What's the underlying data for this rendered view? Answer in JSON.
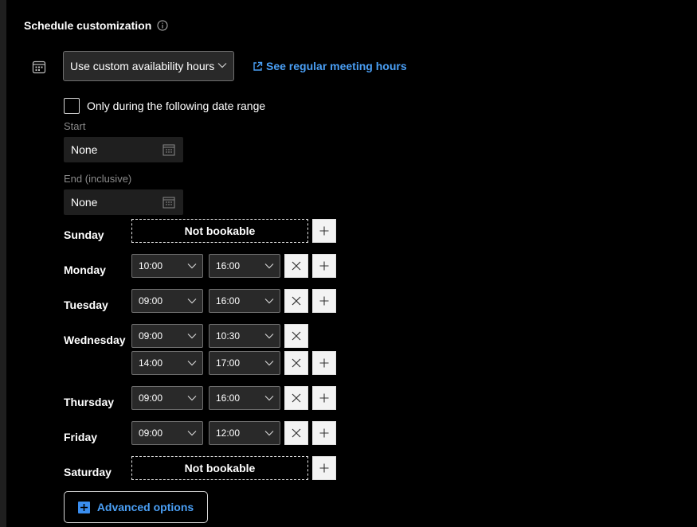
{
  "header": {
    "title": "Schedule customization",
    "info_icon": "info-icon"
  },
  "availability": {
    "mode": "Use custom availability hours",
    "link": "See regular meeting hours",
    "date_range_checkbox": "Only during the following date range",
    "date_range_checked": false
  },
  "dates": {
    "start_label": "Start",
    "start_value": "None",
    "end_label": "End (inclusive)",
    "end_value": "None"
  },
  "days": {
    "sunday": {
      "label": "Sunday",
      "status": "Not bookable"
    },
    "monday": {
      "label": "Monday",
      "slots": [
        {
          "from": "10:00",
          "to": "16:00"
        }
      ]
    },
    "tuesday": {
      "label": "Tuesday",
      "slots": [
        {
          "from": "09:00",
          "to": "16:00"
        }
      ]
    },
    "wednesday": {
      "label": "Wednesday",
      "slots": [
        {
          "from": "09:00",
          "to": "10:30"
        },
        {
          "from": "14:00",
          "to": "17:00"
        }
      ]
    },
    "thursday": {
      "label": "Thursday",
      "slots": [
        {
          "from": "09:00",
          "to": "16:00"
        }
      ]
    },
    "friday": {
      "label": "Friday",
      "slots": [
        {
          "from": "09:00",
          "to": "12:00"
        }
      ]
    },
    "saturday": {
      "label": "Saturday",
      "status": "Not bookable"
    }
  },
  "advanced_options": "Advanced options",
  "colors": {
    "background": "#000000",
    "accent": "#4a9ff5",
    "field": "#292929"
  }
}
